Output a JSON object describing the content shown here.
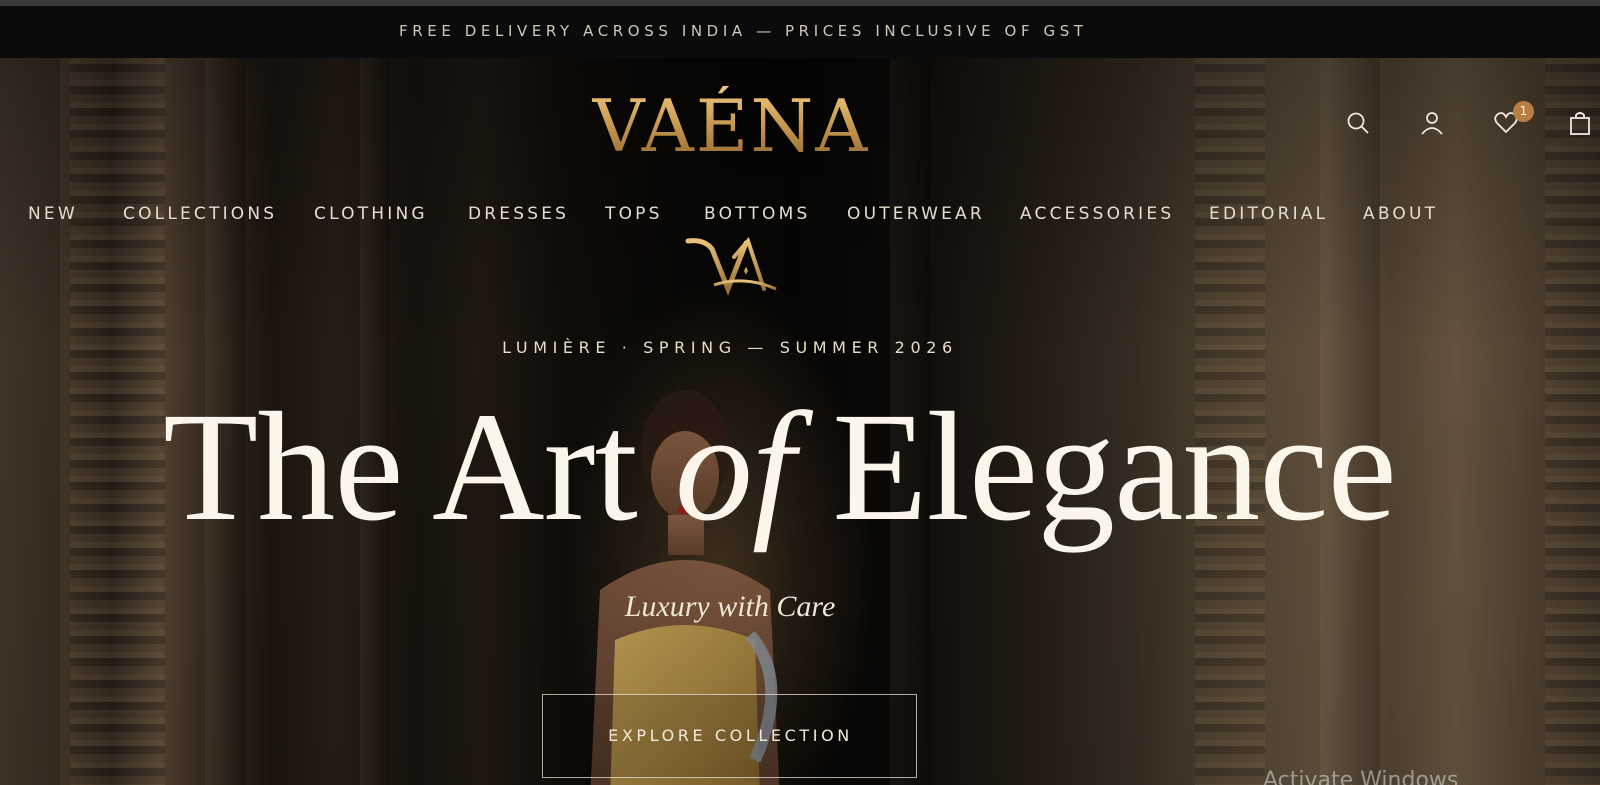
{
  "announcement": {
    "text": "FREE DELIVERY ACROSS INDIA — PRICES INCLUSIVE OF GST"
  },
  "header": {
    "logo_text": "VAÉNA",
    "monogram_text": "VA",
    "icons": [
      "search-icon",
      "account-icon",
      "wishlist-icon",
      "bag-icon"
    ],
    "wishlist_count": "1"
  },
  "nav": {
    "items": [
      {
        "label": "NEW"
      },
      {
        "label": "COLLECTIONS"
      },
      {
        "label": "CLOTHING"
      },
      {
        "label": "DRESSES"
      },
      {
        "label": "TOPS"
      },
      {
        "label": "BOTTOMS"
      },
      {
        "label": "OUTERWEAR"
      },
      {
        "label": "ACCESSORIES"
      },
      {
        "label": "EDITORIAL"
      },
      {
        "label": "ABOUT"
      }
    ]
  },
  "hero": {
    "season": "LUMIÈRE · SPRING — SUMMER 2026",
    "headline_part1": "The Art ",
    "headline_italic": "of",
    "headline_part2": " Elegance",
    "tagline": "Luxury with Care",
    "cta_label": "EXPLORE COLLECTION"
  },
  "os_overlay": {
    "watermark": "Activate Windows"
  },
  "colors": {
    "gold": "#c89a52",
    "badge": "#b87f44",
    "announcement_bg": "#0b0b0b",
    "text_light": "#e6ddcf"
  }
}
